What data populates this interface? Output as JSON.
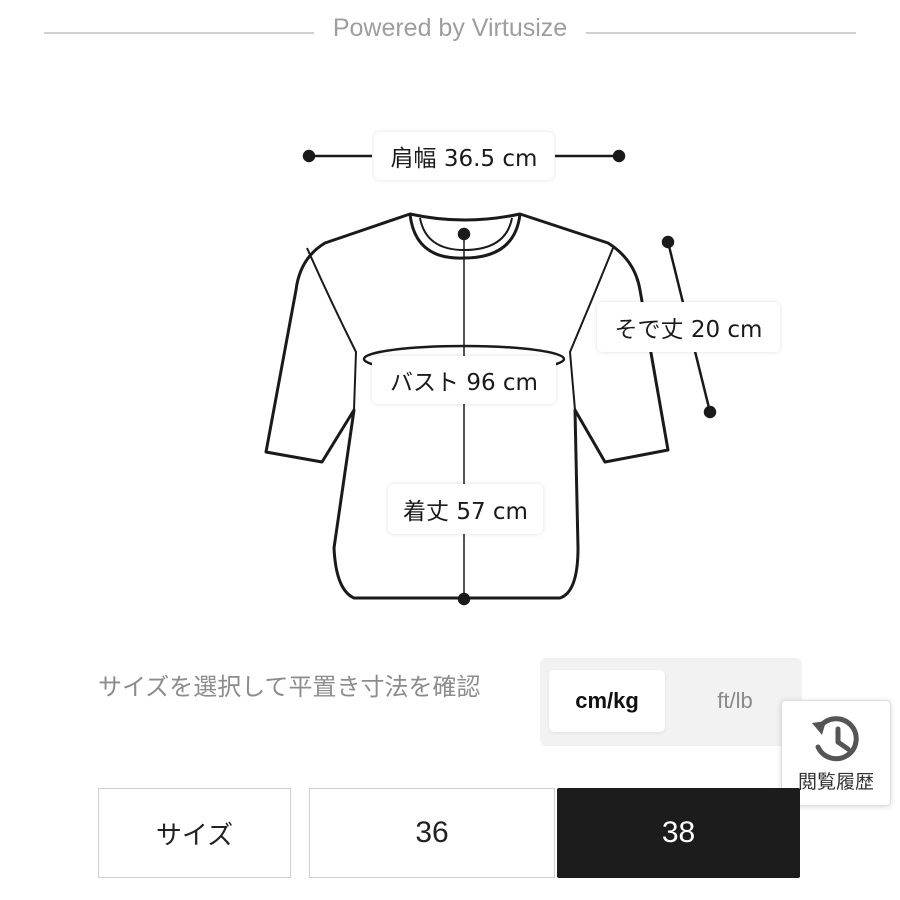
{
  "header": {
    "powered_by": "Powered by Virtusize"
  },
  "measurements": {
    "shoulder": "肩幅 36.5 cm",
    "sleeve": "そで丈 20 cm",
    "bust": "バスト 96 cm",
    "length": "着丈 57 cm"
  },
  "instruction": "サイズを選択して平置き寸法を確認",
  "unit_toggle": {
    "metric_label": "cm/kg",
    "imperial_label": "ft/lb",
    "selected": "cm/kg"
  },
  "history": {
    "label": "閲覧履歴",
    "icon": "history-clock-icon"
  },
  "size_selector": {
    "label": "サイズ",
    "options": [
      "36",
      "38"
    ],
    "selected": "38"
  },
  "colors": {
    "selected_bg": "#1c1c1c",
    "muted_text": "#8c8c8c"
  }
}
